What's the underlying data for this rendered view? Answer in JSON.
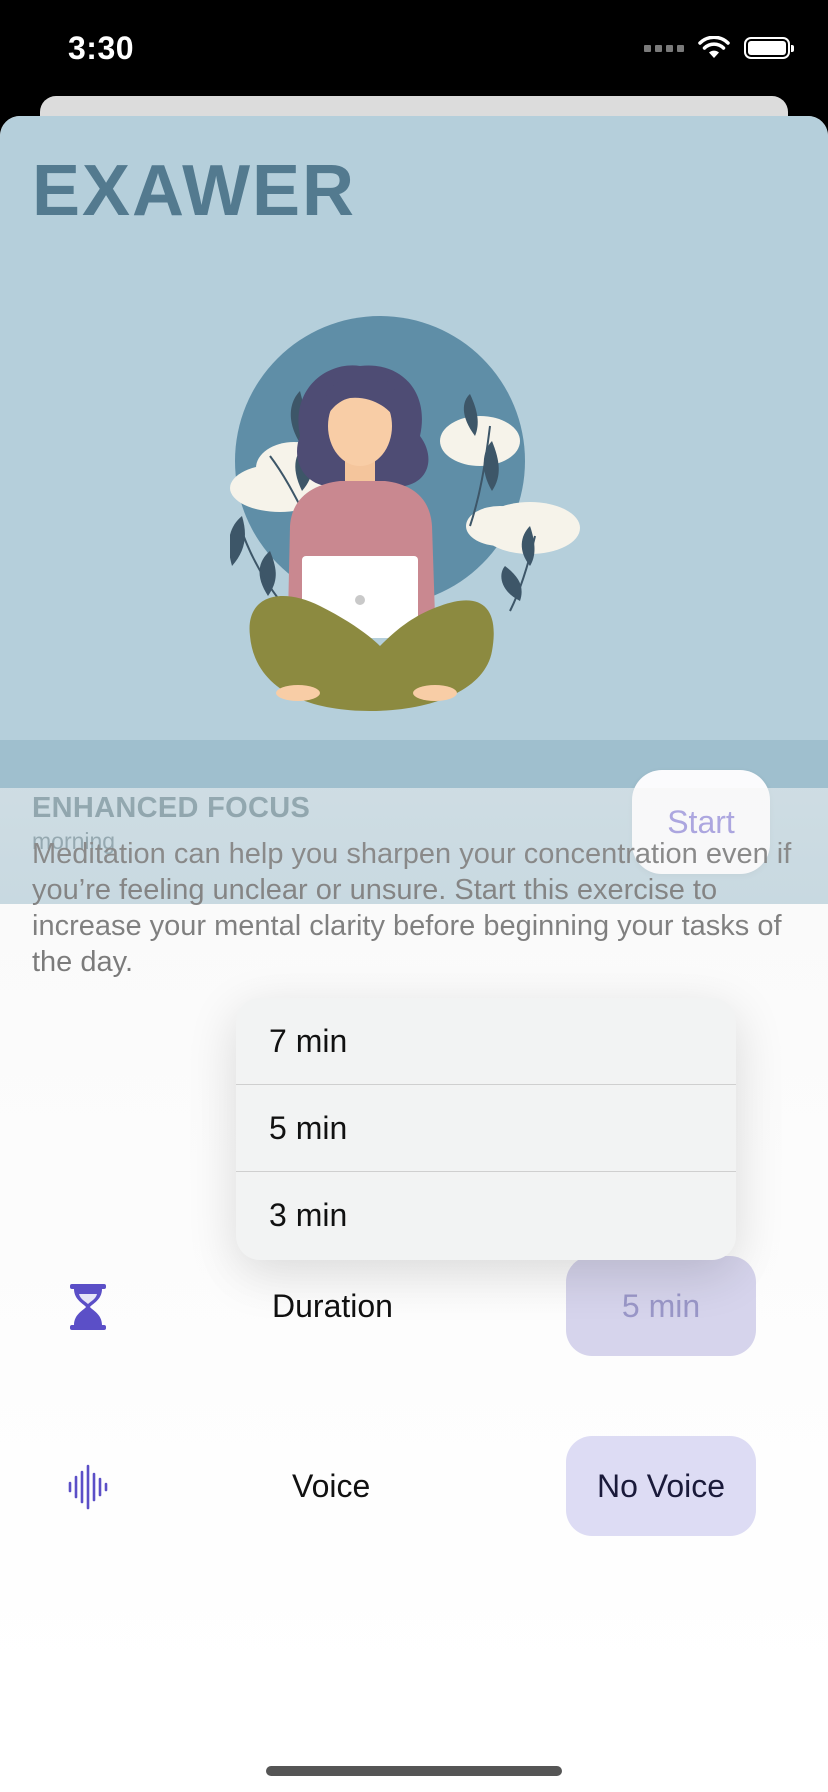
{
  "status_bar": {
    "time": "3:30",
    "icons": [
      "signal-icon",
      "wifi-icon",
      "battery-icon"
    ]
  },
  "brand": {
    "title": "EXAWER"
  },
  "session": {
    "title": "ENHANCED FOCUS",
    "subtitle": "morning",
    "start_label": "Start"
  },
  "description": "Meditation can help you sharpen your concentration even if you’re feeling unclear or unsure. Start this exercise to increase your mental clarity before beginning your tasks of the day.",
  "settings": {
    "duration": {
      "icon": "hourglass-icon",
      "label": "Duration",
      "value": "5 min"
    },
    "voice": {
      "icon": "sound-wave-icon",
      "label": "Voice",
      "value": "No Voice"
    }
  },
  "duration_menu": {
    "options": [
      "7 min",
      "5 min",
      "3 min"
    ]
  },
  "colors": {
    "hero_bg": "#b5cfdb",
    "session_bg": "#9fbfce",
    "brand_text": "#537a8f",
    "accent": "#5b4fc7",
    "voice_button_bg": "#dddcf4"
  }
}
